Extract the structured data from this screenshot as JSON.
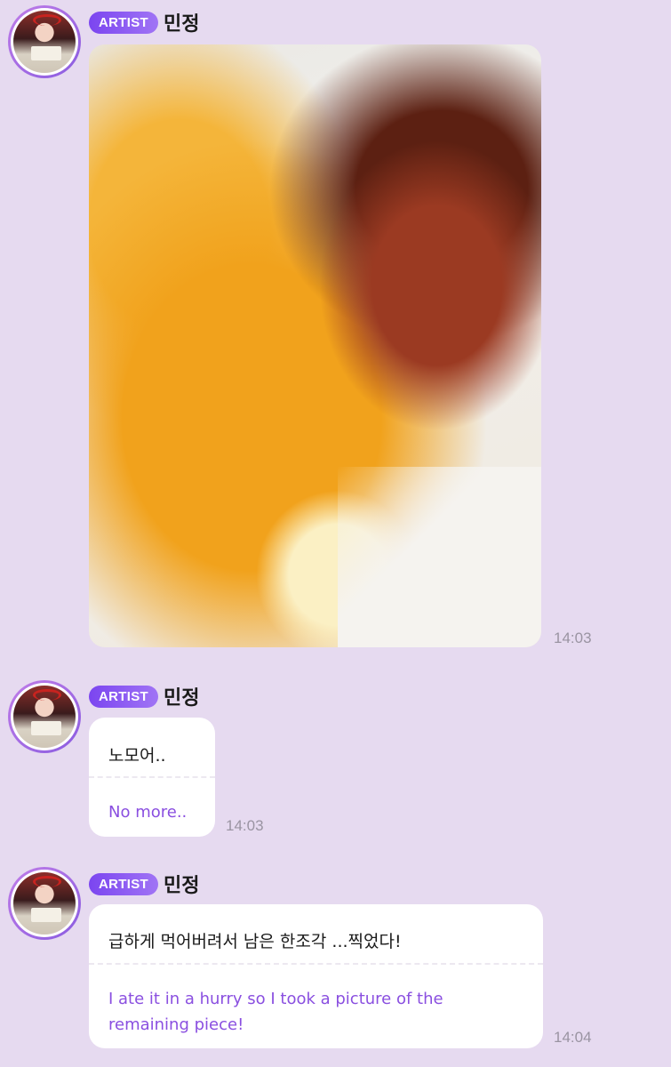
{
  "messages": [
    {
      "type": "image",
      "badge": "ARTIST",
      "sender": "민정",
      "time": "14:03"
    },
    {
      "type": "text",
      "badge": "ARTIST",
      "sender": "민정",
      "text": "노모어..",
      "translation": "No more..",
      "time": "14:03"
    },
    {
      "type": "text",
      "badge": "ARTIST",
      "sender": "민정",
      "text": "급하게 먹어버려서 남은 한조각 ...찍었다!",
      "translation": "I ate it in a hurry so I took a picture of the remaining piece!",
      "time": "14:04"
    }
  ],
  "colors": {
    "background": "#e6daf0",
    "badge": "#7b45f0",
    "translation_text": "#8a4fe0",
    "timestamp": "#9a94a2"
  },
  "icons": {
    "avatar": "artist-avatar"
  }
}
